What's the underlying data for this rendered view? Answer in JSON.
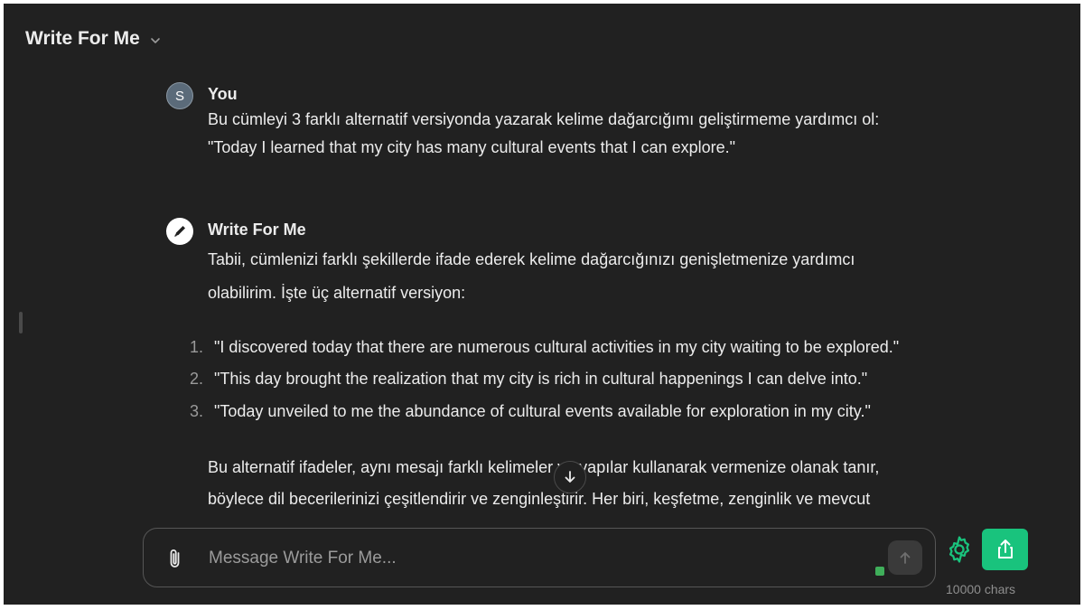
{
  "header": {
    "title": "Write For Me"
  },
  "conversation": {
    "user_message": {
      "avatar_letter": "S",
      "author": "You",
      "lines": [
        "Bu cümleyi 3 farklı alternatif versiyonda yazarak kelime dağarcığımı geliştirmeme yardımcı ol:",
        "\"Today I learned that my city has many cultural events that I can explore.\""
      ]
    },
    "assistant_message": {
      "author": "Write For Me",
      "intro_lines": [
        "Tabii, cümlenizi farklı şekillerde ifade ederek kelime dağarcığınızı genişletmenize yardımcı",
        "olabilirim. İşte üç alternatif versiyon:"
      ],
      "list": [
        {
          "num": "1.",
          "text": "\"I discovered today that there are numerous cultural activities in my city waiting to be explored.\""
        },
        {
          "num": "2.",
          "text": "\"This day brought the realization that my city is rich in cultural happenings I can delve into.\""
        },
        {
          "num": "3.",
          "text": "\"Today unveiled to me the abundance of cultural events available for exploration in my city.\""
        }
      ],
      "outro_lines": [
        "Bu alternatif ifadeler, aynı mesajı farklı kelimeler ve yapılar kullanarak vermenize olanak tanır,",
        "böylece dil becerilerinizi çeşitlendirir ve zenginleştirir. Her biri, keşfetme, zenginlik ve mevcut"
      ]
    }
  },
  "composer": {
    "placeholder": "Message Write For Me...",
    "value": ""
  },
  "footer": {
    "char_count": "10000 chars"
  },
  "icons": {
    "header_dropdown": "chevron-down-icon",
    "assistant_avatar": "pencil-icon",
    "scroll": "arrow-down-icon",
    "attach": "paperclip-icon",
    "send": "arrow-up-icon",
    "settings": "gear-icon",
    "share": "share-icon"
  },
  "colors": {
    "background": "#212121",
    "text": "#ececec",
    "accent_green": "#19c37d",
    "gear_green": "#19c37d"
  }
}
